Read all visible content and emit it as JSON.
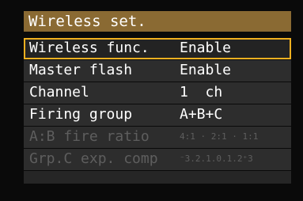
{
  "menu": {
    "title": "Wireless set.",
    "items": [
      {
        "label": "Wireless func.",
        "value": "Enable",
        "selected": true,
        "enabled": true
      },
      {
        "label": "Master flash",
        "value": "Enable",
        "enabled": true
      },
      {
        "label": "Channel",
        "value": "1  ch",
        "enabled": true
      },
      {
        "label": "Firing group",
        "value": "A+B+C",
        "enabled": true
      },
      {
        "label": "A:B fire ratio",
        "value": "4:1 · 2:1 · 1:1",
        "enabled": false
      },
      {
        "label": "Grp.C exp. comp",
        "value": "⁻3.2.1.0.1.2⁺3",
        "enabled": false
      }
    ]
  },
  "colors": {
    "title_bg": "#8a6a33",
    "selection_border": "#f0b020",
    "row_bg": "#2d2d2d",
    "disabled_text": "#5e5e5e"
  }
}
